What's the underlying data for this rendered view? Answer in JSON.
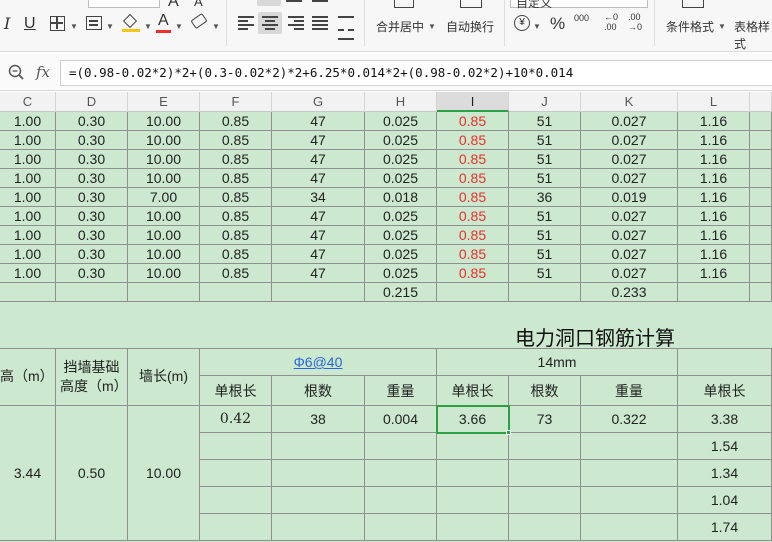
{
  "ribbon": {
    "merge_center": "合并居中",
    "auto_wrap": "自动换行",
    "number_format": "自定义",
    "percent": "%",
    "thousands": "000",
    "cond_format": "条件格式",
    "table_style": "表格样式",
    "underline": "U",
    "italic": "I",
    "font_color_letter": "A",
    "accent_red": "#e8312a"
  },
  "formula_bar": {
    "fx_label": "fx",
    "formula": "=(0.98-0.02*2)*2+(0.3-0.02*2)*2+6.25*0.014*2+(0.98-0.02*2)+10*0.014"
  },
  "columns": [
    "C",
    "D",
    "E",
    "F",
    "G",
    "H",
    "I",
    "J",
    "K",
    "L"
  ],
  "active_column": "I",
  "data_rows": [
    [
      "1.00",
      "0.30",
      "10.00",
      "0.85",
      "47",
      "0.025",
      "0.85",
      "51",
      "0.027",
      "1.16"
    ],
    [
      "1.00",
      "0.30",
      "10.00",
      "0.85",
      "47",
      "0.025",
      "0.85",
      "51",
      "0.027",
      "1.16"
    ],
    [
      "1.00",
      "0.30",
      "10.00",
      "0.85",
      "47",
      "0.025",
      "0.85",
      "51",
      "0.027",
      "1.16"
    ],
    [
      "1.00",
      "0.30",
      "10.00",
      "0.85",
      "47",
      "0.025",
      "0.85",
      "51",
      "0.027",
      "1.16"
    ],
    [
      "1.00",
      "0.30",
      "7.00",
      "0.85",
      "34",
      "0.018",
      "0.85",
      "36",
      "0.019",
      "1.16"
    ],
    [
      "1.00",
      "0.30",
      "10.00",
      "0.85",
      "47",
      "0.025",
      "0.85",
      "51",
      "0.027",
      "1.16"
    ],
    [
      "1.00",
      "0.30",
      "10.00",
      "0.85",
      "47",
      "0.025",
      "0.85",
      "51",
      "0.027",
      "1.16"
    ],
    [
      "1.00",
      "0.30",
      "10.00",
      "0.85",
      "47",
      "0.025",
      "0.85",
      "51",
      "0.027",
      "1.16"
    ],
    [
      "1.00",
      "0.30",
      "10.00",
      "0.85",
      "47",
      "0.025",
      "0.85",
      "51",
      "0.027",
      "1.16"
    ]
  ],
  "totals": {
    "H": "0.215",
    "K": "0.233"
  },
  "section_title": "电力洞口钢筋计算",
  "header": {
    "wall_height": "高（m）",
    "base_height": "挡墙基础高度（m）",
    "wall_length": "墙长(m)",
    "group1": "Φ6@40",
    "group2": "14mm",
    "unit_length": "单根长",
    "count": "根数",
    "weight": "重量"
  },
  "calc_rows": [
    [
      "0.42",
      "38",
      "0.004",
      "3.66",
      "73",
      "0.322",
      "3.38"
    ],
    [
      "",
      "",
      "",
      "",
      "",
      "",
      "1.54"
    ],
    [
      "",
      "",
      "",
      "",
      "",
      "",
      "1.34"
    ],
    [
      "",
      "",
      "",
      "",
      "",
      "",
      "1.04"
    ],
    [
      "",
      "",
      "",
      "",
      "",
      "",
      "1.74"
    ]
  ],
  "merged_values": {
    "wall_height": "3.44",
    "base_height": "0.50",
    "wall_length": "10.00"
  }
}
